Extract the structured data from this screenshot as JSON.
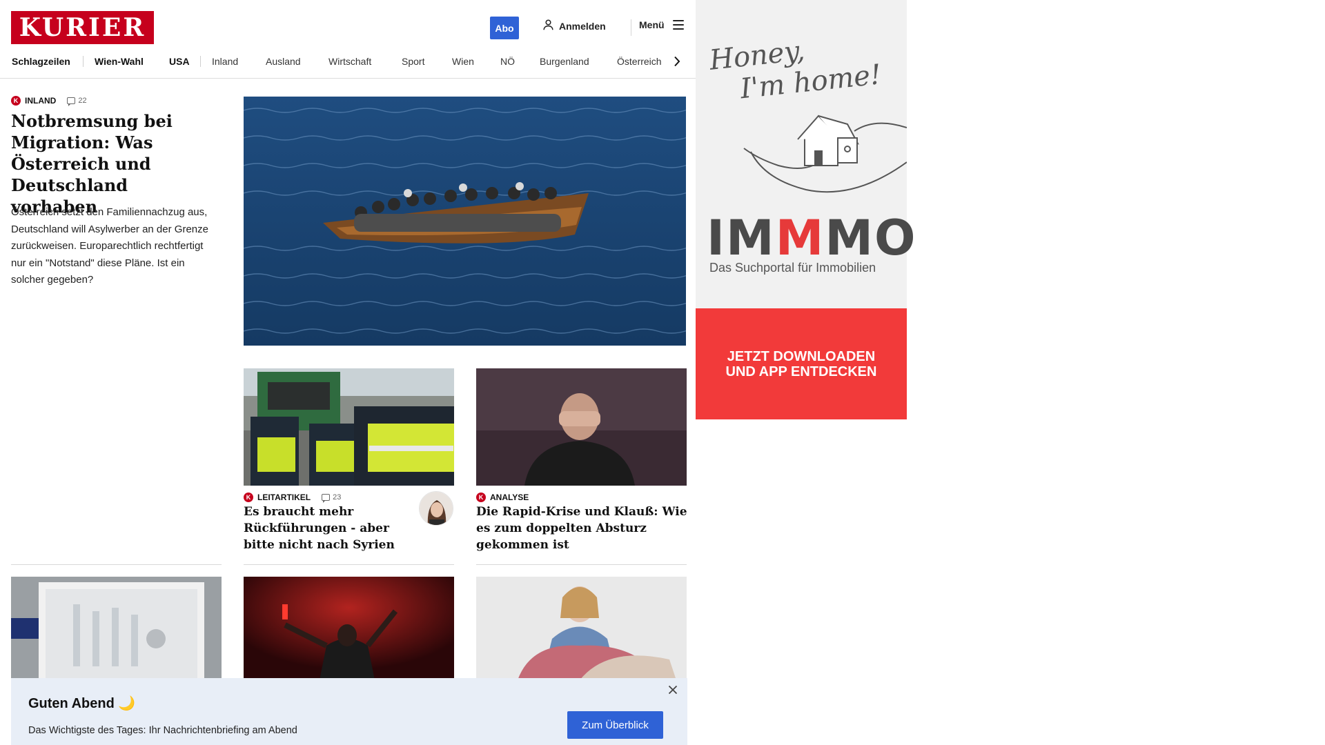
{
  "header": {
    "logo_text": "KURIER",
    "abo_label": "Abo",
    "login_label": "Anmelden",
    "menu_label": "Menü",
    "brand_color": "#c6001d",
    "accent_color": "#2f62d6"
  },
  "nav": {
    "items": [
      "Schlagzeilen",
      "Wien-Wahl",
      "USA",
      "Inland",
      "Ausland",
      "Wirtschaft",
      "Sport",
      "Wien",
      "NÖ",
      "Burgenland",
      "Österreich"
    ]
  },
  "lead": {
    "kicker": "INLAND",
    "comments": "22",
    "title": "Notbremsung bei Migration: Was Österreich und Deutschland vorhaben",
    "teaser": "Österreich setzt den Familiennachzug aus, Deutschland will Asylwerber an der Grenze zurückweisen. Europarechtlich rechtfertigt nur ein \"Notstand\" diese Pläne. Ist ein solcher gegeben?"
  },
  "cards": [
    {
      "kicker": "LEITARTIKEL",
      "comments": "23",
      "title": "Es braucht mehr Rückführungen - aber bitte nicht nach Syrien"
    },
    {
      "kicker": "ANALYSE",
      "title": "Die Rapid-Krise und Klauß: Wie es zum doppelten Absturz gekommen ist"
    }
  ],
  "ad": {
    "script_line1": "Honey,",
    "script_line2": "I'm home!",
    "brand_a": "IM",
    "brand_b": "M",
    "brand_c": "MO",
    "subtitle": "Das Suchportal für Immobilien",
    "cta_line1": "JETZT DOWNLOADEN",
    "cta_line2": "UND APP ENTDECKEN"
  },
  "banner": {
    "title": "Guten Abend 🌙",
    "text": "Das Wichtigste des Tages: Ihr Nachrichtenbriefing am Abend",
    "button": "Zum Überblick"
  }
}
